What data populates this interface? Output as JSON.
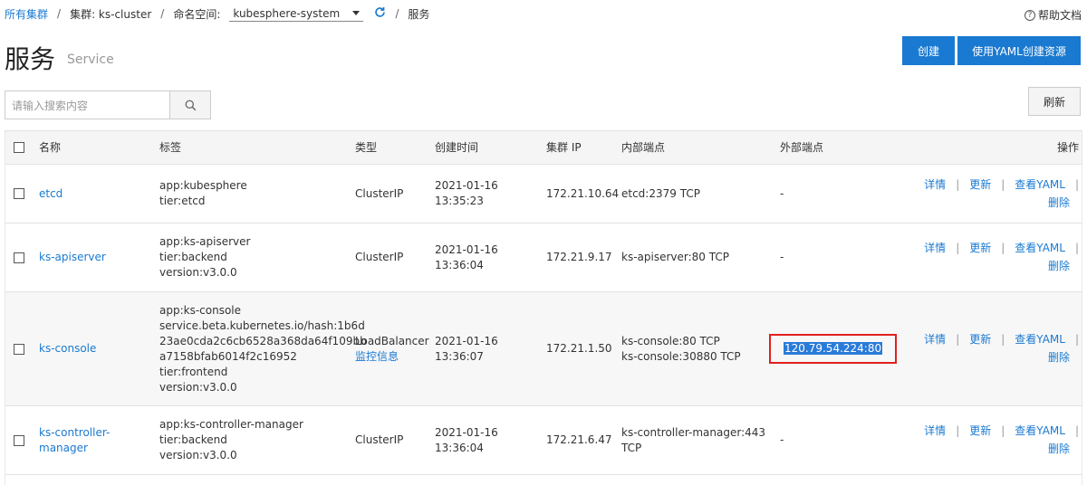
{
  "breadcrumb": {
    "all_clusters": "所有集群",
    "cluster": "集群: ks-cluster",
    "namespace_label": "命名空间:",
    "namespace_value": "kubesphere-system",
    "current": "服务",
    "sep": "/"
  },
  "help": {
    "icon_text": "?",
    "label": "帮助文档"
  },
  "header": {
    "title": "服务",
    "subtitle": "Service",
    "create_label": "创建",
    "yaml_label": "使用YAML创建资源"
  },
  "search": {
    "placeholder": "请输入搜索内容"
  },
  "toolbar": {
    "refresh_label": "刷新"
  },
  "table": {
    "columns": {
      "name": "名称",
      "labels": "标签",
      "type": "类型",
      "created": "创建时间",
      "cluster_ip": "集群 IP",
      "internal": "内部端点",
      "external": "外部端点",
      "ops": "操作"
    },
    "ops_labels": {
      "detail": "详情",
      "update": "更新",
      "yaml": "查看YAML",
      "delete": "删除",
      "sep": "|"
    },
    "rows": [
      {
        "name": [
          "etcd"
        ],
        "labels": [
          "app:kubesphere",
          "tier:etcd"
        ],
        "type": "ClusterIP",
        "type_link": "",
        "created": [
          "2021-01-16",
          "13:35:23"
        ],
        "cluster_ip": "172.21.10.64",
        "internal": [
          "etcd:2379 TCP"
        ],
        "external": "-"
      },
      {
        "name": [
          "ks-apiserver"
        ],
        "labels": [
          "app:ks-apiserver",
          "tier:backend",
          "version:v3.0.0"
        ],
        "type": "ClusterIP",
        "type_link": "",
        "created": [
          "2021-01-16",
          "13:36:04"
        ],
        "cluster_ip": "172.21.9.17",
        "internal": [
          "ks-apiserver:80 TCP"
        ],
        "external": "-"
      },
      {
        "name": [
          "ks-console"
        ],
        "labels": [
          "app:ks-console",
          "service.beta.kubernetes.io/hash:1b6d",
          "23ae0cda2c6cb6528a368da64f109bb",
          "a7158bfab6014f2c16952",
          "tier:frontend",
          "version:v3.0.0"
        ],
        "type": "LoadBalancer",
        "type_link": "监控信息",
        "created": [
          "2021-01-16",
          "13:36:07"
        ],
        "cluster_ip": "172.21.1.50",
        "internal": [
          "ks-console:80 TCP",
          "ks-console:30880 TCP"
        ],
        "external": "120.79.54.224:80"
      },
      {
        "name": [
          "ks-controller-",
          "manager"
        ],
        "labels": [
          "app:ks-controller-manager",
          "tier:backend",
          "version:v3.0.0"
        ],
        "type": "ClusterIP",
        "type_link": "",
        "created": [
          "2021-01-16",
          "13:36:04"
        ],
        "cluster_ip": "172.21.6.47",
        "internal": [
          "ks-controller-manager:443",
          "TCP"
        ],
        "external": "-"
      }
    ]
  }
}
